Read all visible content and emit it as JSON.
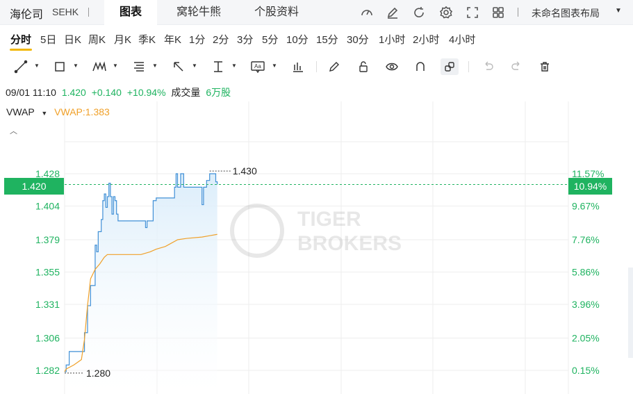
{
  "header": {
    "stock_name": "海伦司",
    "market": "SEHK",
    "tabs": [
      {
        "label": "图表",
        "active": true
      },
      {
        "label": "窝轮牛熊",
        "active": false
      },
      {
        "label": "个股资料",
        "active": false
      }
    ],
    "icons": [
      "gauge-icon",
      "edit-icon",
      "refresh-icon",
      "settings-icon",
      "fullscreen-icon",
      "grid-layout-icon"
    ],
    "layout_label": "未命名图表布局"
  },
  "periods": [
    "分时",
    "5日",
    "日K",
    "周K",
    "月K",
    "季K",
    "年K",
    "1分",
    "2分",
    "3分",
    "5分",
    "10分",
    "15分",
    "30分",
    "1小时",
    "2小时",
    "4小时"
  ],
  "active_period": "分时",
  "info": {
    "datetime": "09/01 11:10",
    "price": "1.420",
    "change": "+0.140",
    "change_pct": "+10.94%",
    "volume_label": "成交量",
    "volume": "6万股"
  },
  "indicator": {
    "name": "VWAP",
    "value_text": "VWAP:1.383"
  },
  "watermark": {
    "line1": "TIGER",
    "line2": "BROKERS"
  },
  "colors": {
    "up": "#1fb360",
    "price_line": "#3f8fd6",
    "vwap_line": "#f0a028",
    "area_fill": "#d9ecfa",
    "grid": "#eeeeee",
    "accent": "#f2b705"
  },
  "chart_data": {
    "type": "line",
    "x_range": [
      "09:30",
      "16:00"
    ],
    "ylim": [
      1.28,
      1.43
    ],
    "y_ticks": [
      "1.428",
      "1.404",
      "1.379",
      "1.355",
      "1.331",
      "1.306",
      "1.282"
    ],
    "pct_ticks": [
      "11.57%",
      "9.67%",
      "7.76%",
      "5.86%",
      "3.96%",
      "2.05%",
      "0.15%"
    ],
    "current_price": "1.420",
    "current_pct": "10.94%",
    "high_label": "1.430",
    "low_label": "1.280",
    "series": [
      {
        "key": "price",
        "x": [
          "09:30",
          "09:31",
          "09:33",
          "09:36",
          "09:41",
          "09:43",
          "09:45",
          "09:47",
          "09:50",
          "09:51",
          "09:52",
          "09:53",
          "09:54",
          "09:55",
          "09:56",
          "09:57",
          "09:58",
          "09:59",
          "10:00",
          "10:01",
          "10:02",
          "10:03",
          "10:04",
          "10:05",
          "10:06",
          "10:10",
          "10:17",
          "10:20",
          "10:23",
          "10:24",
          "10:26",
          "10:28",
          "10:30",
          "10:33",
          "10:40",
          "10:42",
          "10:43",
          "10:44",
          "10:46",
          "10:48",
          "10:51",
          "10:53",
          "10:58",
          "11:00",
          "11:01",
          "11:03",
          "11:05",
          "11:06",
          "11:07",
          "11:08",
          "11:09",
          "11:10"
        ],
        "values": [
          1.281,
          1.286,
          1.296,
          1.296,
          1.296,
          1.31,
          1.33,
          1.345,
          1.375,
          1.37,
          1.385,
          1.385,
          1.394,
          1.408,
          1.413,
          1.403,
          1.411,
          1.421,
          1.411,
          1.398,
          1.411,
          1.408,
          1.398,
          1.393,
          1.393,
          1.393,
          1.393,
          1.393,
          1.388,
          1.393,
          1.393,
          1.408,
          1.41,
          1.41,
          1.41,
          1.418,
          1.428,
          1.418,
          1.428,
          1.418,
          1.418,
          1.418,
          1.418,
          1.405,
          1.418,
          1.423,
          1.428,
          1.428,
          1.428,
          1.428,
          1.422,
          1.42
        ]
      },
      {
        "key": "vwap",
        "x": [
          "09:30",
          "09:31",
          "09:36",
          "09:41",
          "09:43",
          "09:45",
          "09:47",
          "09:50",
          "09:53",
          "09:56",
          "09:58",
          "10:03",
          "10:10",
          "10:20",
          "10:26",
          "10:30",
          "10:36",
          "10:44",
          "10:50",
          "11:00",
          "11:05",
          "11:10"
        ],
        "values": [
          1.281,
          1.283,
          1.286,
          1.29,
          1.305,
          1.33,
          1.35,
          1.357,
          1.361,
          1.366,
          1.368,
          1.368,
          1.368,
          1.368,
          1.37,
          1.372,
          1.374,
          1.379,
          1.38,
          1.381,
          1.382,
          1.383
        ]
      }
    ]
  }
}
